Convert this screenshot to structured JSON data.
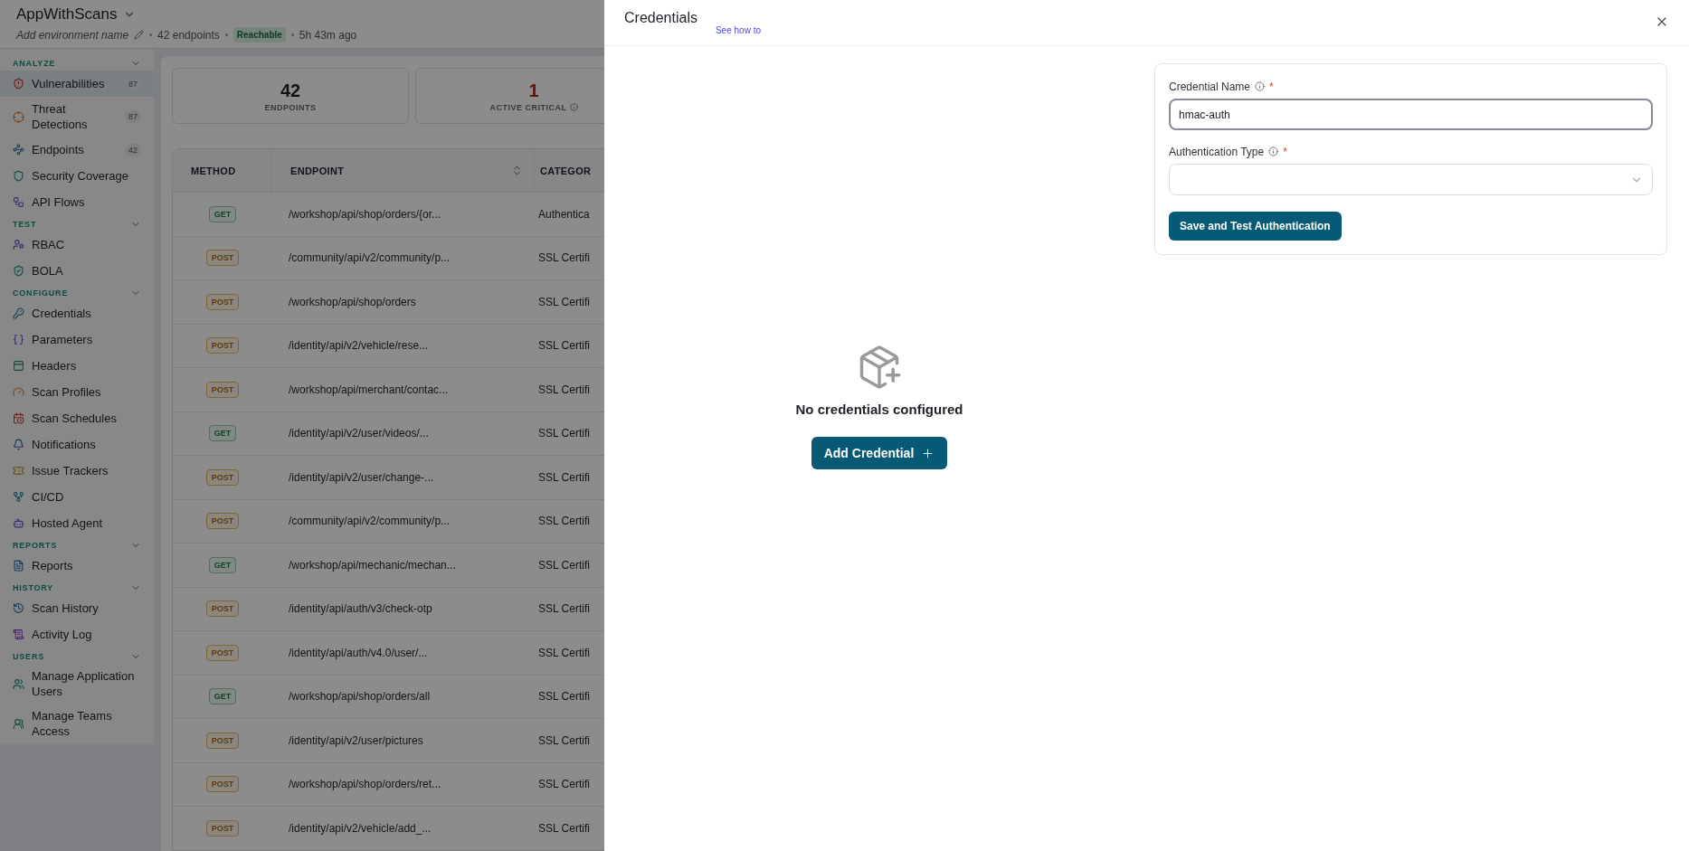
{
  "app": {
    "title": "AppWithScans",
    "environment_placeholder": "Add environment name",
    "endpoint_count": "42 endpoints",
    "status": "Reachable",
    "last_scan": "5h 43m ago"
  },
  "sidebar": {
    "sections": [
      {
        "label": "ANALYZE",
        "expanded": true,
        "items": [
          {
            "label": "Vulnerabilities",
            "count": "87",
            "selected": true
          },
          {
            "label": "Threat Detections",
            "count": "87",
            "selected": false
          },
          {
            "label": "Endpoints",
            "count": "42",
            "selected": false
          },
          {
            "label": "Security Coverage",
            "selected": false
          },
          {
            "label": "API Flows",
            "selected": false
          }
        ]
      },
      {
        "label": "TEST",
        "expanded": true,
        "items": [
          {
            "label": "RBAC",
            "selected": false
          },
          {
            "label": "BOLA",
            "selected": false
          }
        ]
      },
      {
        "label": "CONFIGURE",
        "expanded": true,
        "items": [
          {
            "label": "Credentials",
            "selected": false
          },
          {
            "label": "Parameters",
            "selected": false
          },
          {
            "label": "Headers",
            "selected": false
          },
          {
            "label": "Scan Profiles",
            "selected": false
          },
          {
            "label": "Scan Schedules",
            "selected": false
          },
          {
            "label": "Notifications",
            "selected": false
          },
          {
            "label": "Issue Trackers",
            "selected": false
          },
          {
            "label": "CI/CD",
            "selected": false
          },
          {
            "label": "Hosted Agent",
            "selected": false
          }
        ]
      },
      {
        "label": "REPORTS",
        "expanded": true,
        "items": [
          {
            "label": "Reports",
            "selected": false
          }
        ]
      },
      {
        "label": "HISTORY",
        "expanded": true,
        "items": [
          {
            "label": "Scan History",
            "selected": false
          },
          {
            "label": "Activity Log",
            "selected": false
          }
        ]
      },
      {
        "label": "USERS",
        "expanded": true,
        "items": [
          {
            "label": "Manage Application Users",
            "selected": false
          },
          {
            "label": "Manage Teams Access",
            "selected": false
          }
        ]
      }
    ]
  },
  "stats": [
    {
      "value": "42",
      "label": "ENDPOINTS",
      "kind": "normal",
      "info": false
    },
    {
      "value": "1",
      "label": "ACTIVE CRITICAL",
      "kind": "critical",
      "info": true
    }
  ],
  "table": {
    "columns": [
      {
        "label": "METHOD",
        "sortable": false
      },
      {
        "label": "ENDPOINT",
        "sortable": true
      },
      {
        "label": "CATEGOR",
        "sortable": false
      }
    ],
    "rows": [
      {
        "method": "GET",
        "kind": "get",
        "endpoint": "/workshop/api/shop/orders/{or...",
        "category": "Authentica"
      },
      {
        "method": "POST",
        "kind": "post",
        "endpoint": "/community/api/v2/community/p...",
        "category": "SSL Certifi"
      },
      {
        "method": "POST",
        "kind": "post",
        "endpoint": "/workshop/api/shop/orders",
        "category": "SSL Certifi"
      },
      {
        "method": "POST",
        "kind": "post",
        "endpoint": "/identity/api/v2/vehicle/rese...",
        "category": "SSL Certifi"
      },
      {
        "method": "POST",
        "kind": "post",
        "endpoint": "/workshop/api/merchant/contac...",
        "category": "SSL Certifi"
      },
      {
        "method": "GET",
        "kind": "get",
        "endpoint": "/identity/api/v2/user/videos/...",
        "category": "SSL Certifi"
      },
      {
        "method": "POST",
        "kind": "post",
        "endpoint": "/identity/api/v2/user/change-...",
        "category": "SSL Certifi"
      },
      {
        "method": "POST",
        "kind": "post",
        "endpoint": "/community/api/v2/community/p...",
        "category": "SSL Certifi"
      },
      {
        "method": "GET",
        "kind": "get",
        "endpoint": "/workshop/api/mechanic/mechan...",
        "category": "SSL Certifi"
      },
      {
        "method": "POST",
        "kind": "post",
        "endpoint": "/identity/api/auth/v3/check-otp",
        "category": "SSL Certifi"
      },
      {
        "method": "POST",
        "kind": "post",
        "endpoint": "/identity/api/auth/v4.0/user/...",
        "category": "SSL Certifi"
      },
      {
        "method": "GET",
        "kind": "get",
        "endpoint": "/workshop/api/shop/orders/all",
        "category": "SSL Certifi"
      },
      {
        "method": "POST",
        "kind": "post",
        "endpoint": "/identity/api/v2/user/pictures",
        "category": "SSL Certifi"
      },
      {
        "method": "POST",
        "kind": "post",
        "endpoint": "/workshop/api/shop/orders/ret...",
        "category": "SSL Certifi"
      },
      {
        "method": "POST",
        "kind": "post",
        "endpoint": "/identity/api/v2/vehicle/add_...",
        "category": "SSL Certifi"
      }
    ]
  },
  "drawer": {
    "title": "Credentials",
    "help_link": "See how to",
    "empty_state": {
      "message": "No credentials configured",
      "button": "Add Credential"
    },
    "form": {
      "fields": [
        {
          "kind": "text",
          "label": "Credential Name",
          "info": true,
          "required_mark": "*",
          "value": "hmac-auth",
          "focused": true
        },
        {
          "kind": "select",
          "label": "Authentication Type",
          "info": true,
          "required_mark": "*",
          "focused": false
        }
      ],
      "submit": "Save and Test Authentication"
    }
  }
}
